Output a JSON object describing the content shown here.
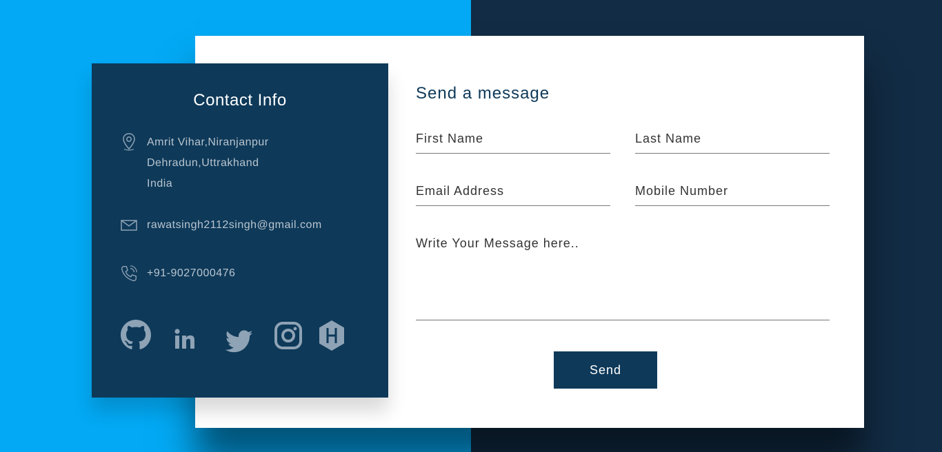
{
  "colors": {
    "left_background": "#03a9f4",
    "right_background": "#122c45",
    "panel": "#0e3959",
    "card": "#ffffff"
  },
  "contact_info": {
    "title": "Contact Info",
    "address": {
      "icon": "location-pin-icon",
      "line1": "Amrit Vihar,Niranjanpur",
      "line2": "Dehradun,Uttrakhand",
      "line3": "India"
    },
    "email": {
      "icon": "envelope-icon",
      "value": "rawatsingh2112singh@gmail.com"
    },
    "phone": {
      "icon": "phone-icon",
      "value": "+91-9027000476"
    },
    "socials": [
      "github-icon",
      "linkedin-icon",
      "twitter-icon",
      "instagram-icon",
      "hackerrank-icon"
    ]
  },
  "form": {
    "title": "Send a message",
    "first_name_placeholder": "First Name",
    "last_name_placeholder": "Last Name",
    "email_placeholder": "Email Address",
    "mobile_placeholder": "Mobile Number",
    "message_placeholder": "Write Your Message here..",
    "send_label": "Send"
  }
}
